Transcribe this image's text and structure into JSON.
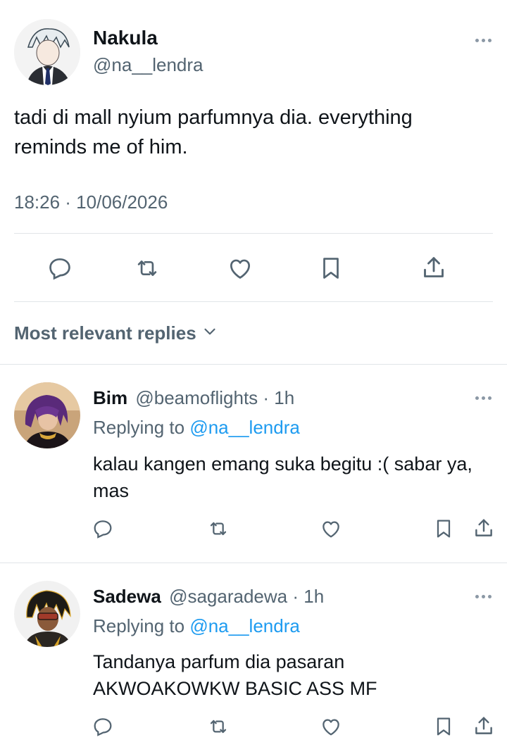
{
  "main_tweet": {
    "display_name": "Nakula",
    "handle": "@na__lendra",
    "text": "tadi di mall nyium parfumnya dia. everything reminds me of him.",
    "timestamp": "18:26 · 10/06/2026",
    "actions": [
      "reply-icon",
      "retweet-icon",
      "like-icon",
      "bookmark-icon",
      "share-icon"
    ]
  },
  "replies_header": {
    "label": "Most relevant replies"
  },
  "replies": [
    {
      "display_name": "Bim",
      "handle": "@beamoflights",
      "time": "· 1h",
      "replying_prefix": "Replying to",
      "replying_to": "@na__lendra",
      "text": "kalau kangen emang suka begitu :( sabar ya, mas"
    },
    {
      "display_name": "Sadewa",
      "handle": "@sagaradewa",
      "time": "· 1h",
      "replying_prefix": "Replying to",
      "replying_to": "@na__lendra",
      "text": "Tandanya parfum dia pasaran AKWOAKOWKW BASIC ASS MF"
    }
  ],
  "colors": {
    "accent": "#1d9bf0",
    "muted": "#536471",
    "divider": "#e1e5e8"
  }
}
